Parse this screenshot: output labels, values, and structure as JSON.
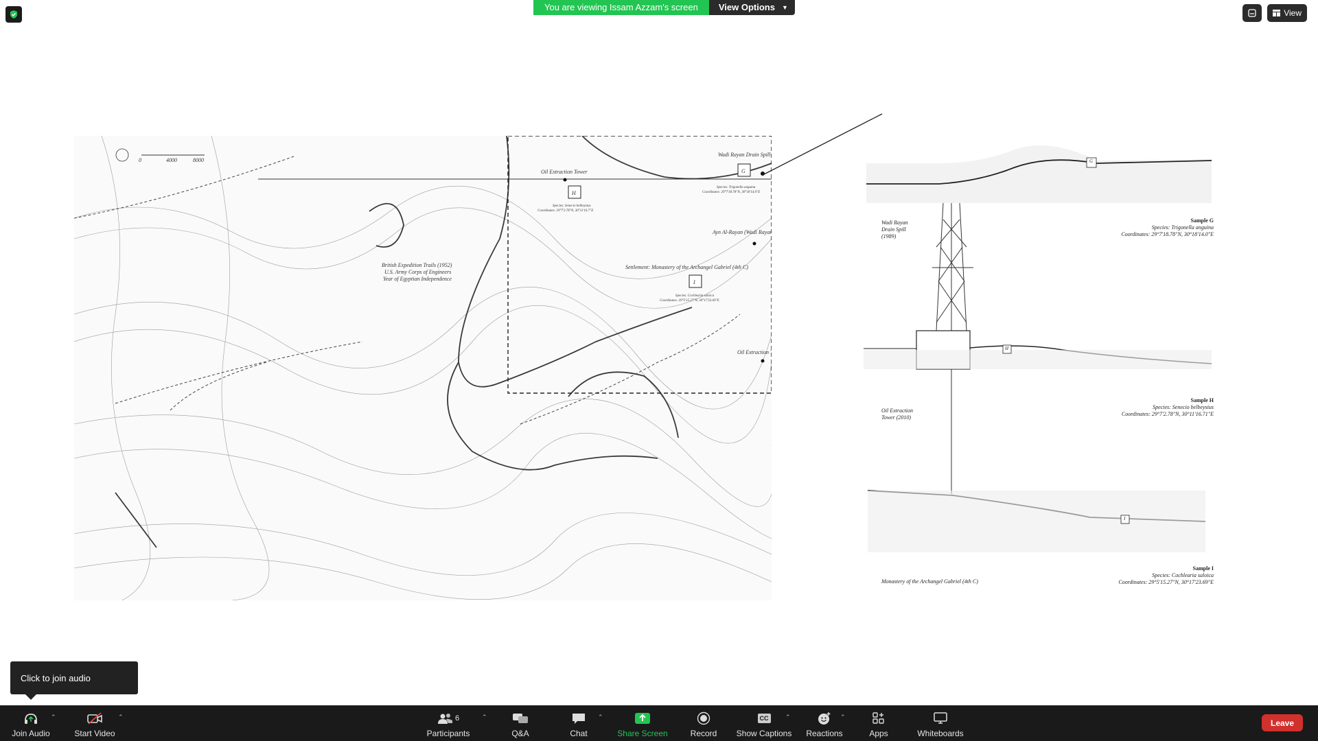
{
  "banner": {
    "viewing": "You are viewing Issam Azzam's screen",
    "options": "View Options"
  },
  "topright": {
    "view": "View"
  },
  "map": {
    "labels": {
      "tower_top": "Oil Extraction Tower",
      "wadi_drain": "Wadi Rayan Drain Spill",
      "ayn_rayan": "Ayn Al-Rayan (Wadi Rayan Spring)",
      "settlement": "Settlement: Monastery of the Archangel Gabriel (4th C)",
      "tower_bottom": "Oil Extraction Tower",
      "trail1": "British Expedition Trails (1952)",
      "trail2": "U.S. Army Corps of Engineers",
      "trail3": "Year of Egyptian Independence",
      "scale_a": "0",
      "scale_b": "4000",
      "scale_c": "8000",
      "marker_h": "H",
      "marker_i": "I",
      "marker_g": "G",
      "species_h": "Species: Senecio belbeysius",
      "coords_h": "Coordinates: 29°7'2.78\"N, 30°11'16.7\"E",
      "species_g": "Species: Trigonella anguina",
      "coords_g": "Coordinates: 29°7'18.78\"N, 30°18'14.0\"E",
      "species_i": "Species: Cochlearia saloica",
      "coords_i": "Coordinates: 29°5'15.27\"N, 30°17'23.69\"E"
    }
  },
  "diagram": {
    "wadi_drain": [
      "Wadi Rayan",
      "Drain Spill",
      "(1989)"
    ],
    "sample_g": {
      "title": "Sample G",
      "species": "Species: Trigonella anguina",
      "coords": "Coordinates: 29°7'18.78\"N, 30°18'14.0\"E"
    },
    "tower": [
      "Oil Extraction",
      "Tower (2010)"
    ],
    "sample_h": {
      "title": "Sample H",
      "species": "Species: Senecio belbeysius",
      "coords": "Coordinates: 29°7'2.78\"N, 30°11'16.71\"E"
    },
    "monastery": "Monastery of the Archangel Gabriel (4th C)",
    "sample_i": {
      "title": "Sample I",
      "species": "Species: Cochlearia saloica",
      "coords": "Coordinates: 29°5'15.27\"N, 30°17'23.69\"E"
    },
    "marker_g": "G",
    "marker_h": "H",
    "marker_i": "I"
  },
  "tooltip": "Click to join audio",
  "toolbar": {
    "join_audio": "Join Audio",
    "start_video": "Start Video",
    "participants": "Participants",
    "participants_count": "6",
    "qa": "Q&A",
    "chat": "Chat",
    "share_screen": "Share Screen",
    "record": "Record",
    "show_captions": "Show Captions",
    "reactions": "Reactions",
    "apps": "Apps",
    "whiteboards": "Whiteboards",
    "leave": "Leave",
    "cc": "CC"
  },
  "colors": {
    "share_green": "#23c552",
    "leave_red": "#d0312d",
    "toolbar_bg": "#1a1a1a"
  },
  "icons": [
    "shield-icon",
    "headphones-icon",
    "video-off-icon",
    "participants-icon",
    "qa-icon",
    "chat-icon",
    "share-screen-icon",
    "record-icon",
    "captions-icon",
    "reactions-icon",
    "apps-icon",
    "whiteboards-icon",
    "chevron-down-icon",
    "view-grid-icon",
    "minimize-icon"
  ]
}
